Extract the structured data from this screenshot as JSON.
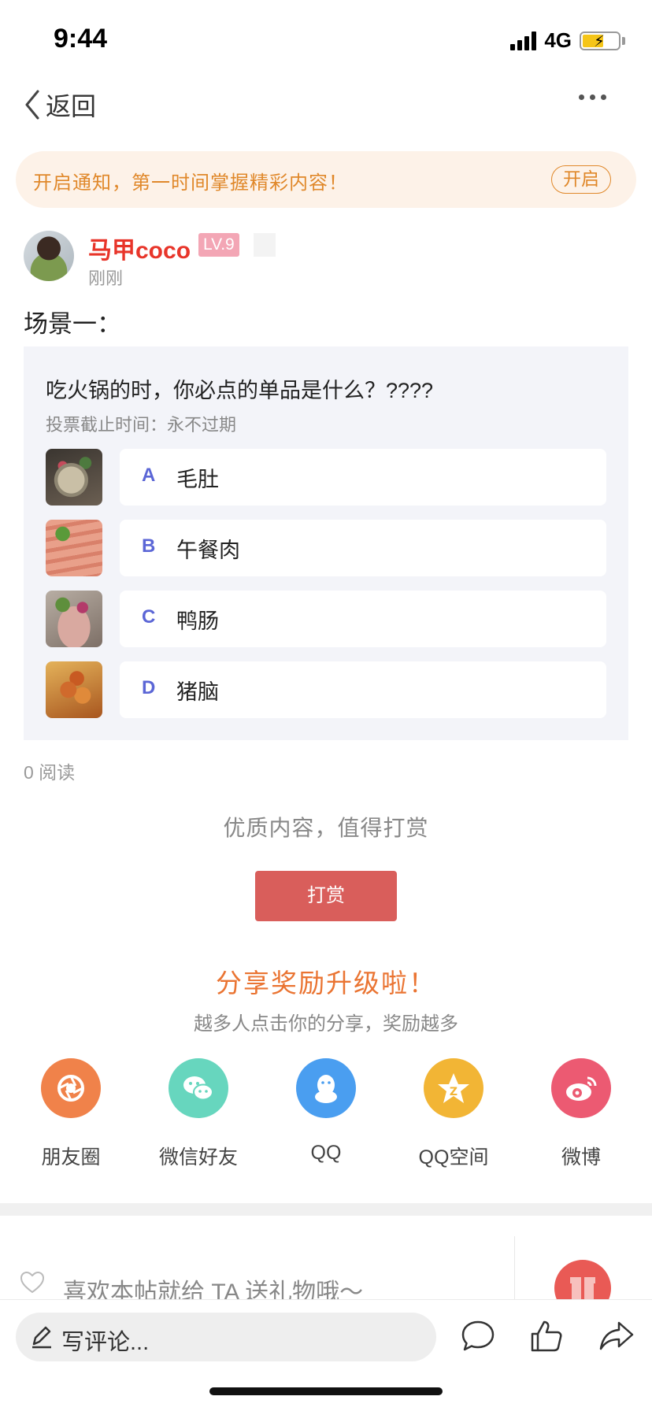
{
  "status_bar": {
    "time": "9:44",
    "network": "4G"
  },
  "nav": {
    "back_label": "返回"
  },
  "notice": {
    "text": "开启通知，第一时间掌握精彩内容！",
    "button": "开启"
  },
  "author": {
    "name": "马甲coco",
    "level": "LV.9",
    "time": "刚刚"
  },
  "post": {
    "title": "场景一："
  },
  "vote": {
    "question": "吃火锅的时，你必点的单品是什么？????",
    "deadline": "投票截止时间：永不过期",
    "options": [
      {
        "letter": "A",
        "label": "毛肚",
        "image": "tripe-photo"
      },
      {
        "letter": "B",
        "label": "午餐肉",
        "image": "luncheon-meat-photo"
      },
      {
        "letter": "C",
        "label": "鸭肠",
        "image": "duck-intestine-photo"
      },
      {
        "letter": "D",
        "label": "猪脑",
        "image": "pig-brain-photo"
      }
    ]
  },
  "stats": {
    "reads": "0 阅读"
  },
  "reward": {
    "hint": "优质内容，值得打赏",
    "button": "打赏"
  },
  "share": {
    "title": "分享奖励升级啦！",
    "subtitle": "越多人点击你的分享，奖励越多",
    "targets": [
      {
        "label": "朋友圈",
        "icon": "moments-icon",
        "color": "#f0824a"
      },
      {
        "label": "微信好友",
        "icon": "wechat-icon",
        "color": "#67d6be"
      },
      {
        "label": "QQ",
        "icon": "qq-icon",
        "color": "#4a9ef0"
      },
      {
        "label": "QQ空间",
        "icon": "qzone-icon",
        "color": "#f2b535"
      },
      {
        "label": "微博",
        "icon": "weibo-icon",
        "color": "#ec5a72"
      }
    ]
  },
  "gift": {
    "text": "喜欢本帖就给 TA 送礼物哦～"
  },
  "bottom_bar": {
    "comment_placeholder": "写评论..."
  },
  "colors": {
    "accent_red": "#e8352a",
    "notice_orange": "#e0882a",
    "reward_button": "#d95e5b",
    "vote_letter": "#5b66d6"
  }
}
